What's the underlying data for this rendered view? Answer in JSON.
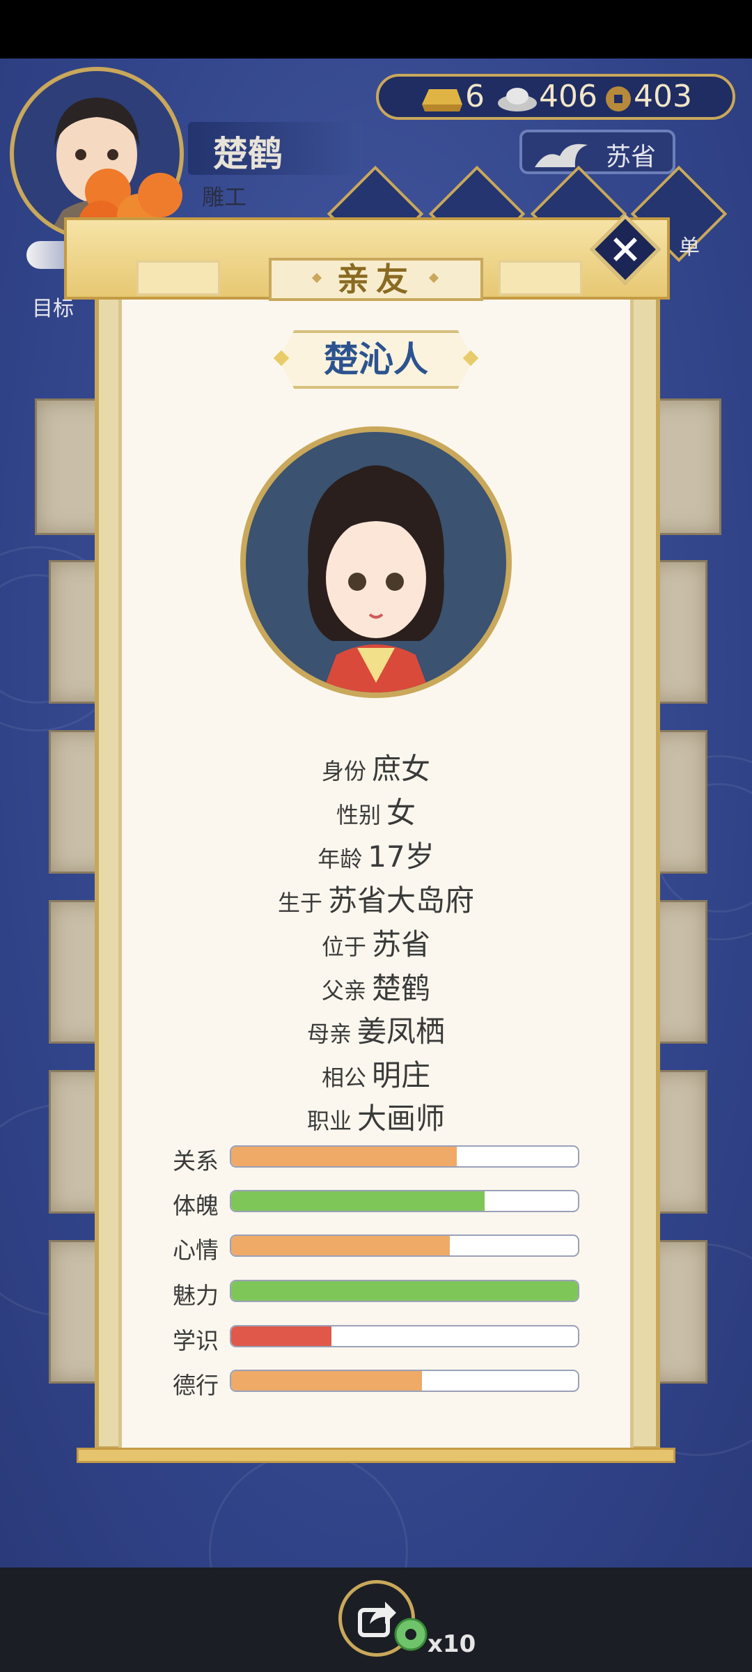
{
  "player": {
    "name": "楚鹤",
    "occupation": "雕工",
    "goal_label": "目标"
  },
  "currency": {
    "gold": "6",
    "silver": "406",
    "coins": "403"
  },
  "region": {
    "label": "苏省"
  },
  "menu": {
    "partial_label": "单"
  },
  "modal": {
    "title": "亲友",
    "character_name": "楚沁人",
    "info": [
      {
        "key": "身份",
        "value": "庶女"
      },
      {
        "key": "性别",
        "value": "女"
      },
      {
        "key": "年龄",
        "value": "17岁"
      },
      {
        "key": "生于",
        "value": "苏省大岛府"
      },
      {
        "key": "位于",
        "value": "苏省"
      },
      {
        "key": "父亲",
        "value": "楚鹤"
      },
      {
        "key": "母亲",
        "value": "姜凤栖"
      },
      {
        "key": "相公",
        "value": "明庄"
      },
      {
        "key": "职业",
        "value": "大画师"
      }
    ],
    "stats": [
      {
        "label": "关系",
        "fraction": 0.65,
        "color": "#efaa68"
      },
      {
        "label": "体魄",
        "fraction": 0.73,
        "color": "#7fc659"
      },
      {
        "label": "心情",
        "fraction": 0.63,
        "color": "#efaa68"
      },
      {
        "label": "魅力",
        "fraction": 1.0,
        "color": "#7fc659"
      },
      {
        "label": "学识",
        "fraction": 0.29,
        "color": "#e0584a"
      },
      {
        "label": "德行",
        "fraction": 0.55,
        "color": "#efaa68"
      }
    ]
  },
  "share": {
    "count": "x10"
  },
  "icons": {
    "close": "close-icon",
    "share": "share-icon",
    "gold": "gold-ingot-icon",
    "silver": "silver-ingot-icon",
    "coin": "copper-coin-icon",
    "region": "mountain-region-icon"
  }
}
